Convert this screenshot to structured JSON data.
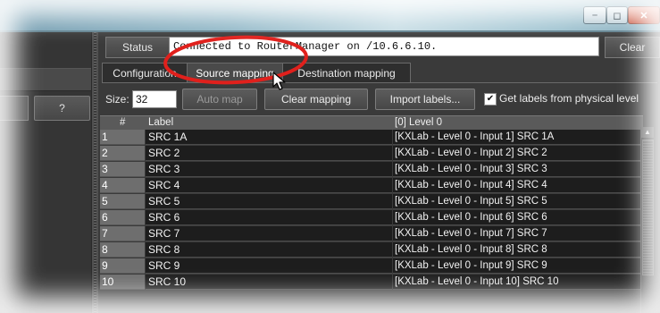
{
  "window": {
    "minimize_glyph": "–",
    "restore_glyph": "◻",
    "close_glyph": "✕"
  },
  "left_panel": {
    "help_label": "?"
  },
  "status": {
    "label": "Status",
    "text": "Connected to RouterManager on /10.6.6.10.",
    "clear_label": "Clear"
  },
  "tabs": [
    {
      "label": "Configuration",
      "active": false
    },
    {
      "label": "Source mapping",
      "active": true
    },
    {
      "label": "Destination mapping",
      "active": false
    }
  ],
  "toolbar": {
    "size_label": "Size:",
    "size_value": "32",
    "auto_map_label": "Auto map",
    "clear_mapping_label": "Clear mapping",
    "import_labels_label": "Import labels...",
    "get_labels_checked": true,
    "get_labels_label": "Get labels from physical level"
  },
  "table": {
    "columns": [
      "#",
      "Label",
      "[0] Level 0"
    ],
    "rows": [
      {
        "num": "1",
        "label": "SRC 1A",
        "level": "[KXLab - Level 0 - Input 1] SRC 1A"
      },
      {
        "num": "2",
        "label": "SRC  2",
        "level": "[KXLab - Level 0 - Input 2] SRC  2"
      },
      {
        "num": "3",
        "label": "SRC  3",
        "level": "[KXLab - Level 0 - Input 3] SRC  3"
      },
      {
        "num": "4",
        "label": "SRC  4",
        "level": "[KXLab - Level 0 - Input 4] SRC  4"
      },
      {
        "num": "5",
        "label": "SRC  5",
        "level": "[KXLab - Level 0 - Input 5] SRC  5"
      },
      {
        "num": "6",
        "label": "SRC  6",
        "level": "[KXLab - Level 0 - Input 6] SRC  6"
      },
      {
        "num": "7",
        "label": "SRC  7",
        "level": "[KXLab - Level 0 - Input 7] SRC  7"
      },
      {
        "num": "8",
        "label": "SRC  8",
        "level": "[KXLab - Level 0 - Input 8] SRC  8"
      },
      {
        "num": "9",
        "label": "SRC  9",
        "level": "[KXLab - Level 0 - Input 9] SRC  9"
      },
      {
        "num": "10",
        "label": "SRC 10",
        "level": "[KXLab - Level 0 - Input 10] SRC 10"
      }
    ]
  },
  "colors": {
    "highlight_ring": "#e0201c",
    "panel_bg": "#3a3a3a",
    "cell_bg": "#1d1d1d"
  },
  "icons": {
    "cursor": "mouse-pointer-icon",
    "checkbox": "checkmark-icon",
    "scroll_up": "arrow-up-icon"
  }
}
